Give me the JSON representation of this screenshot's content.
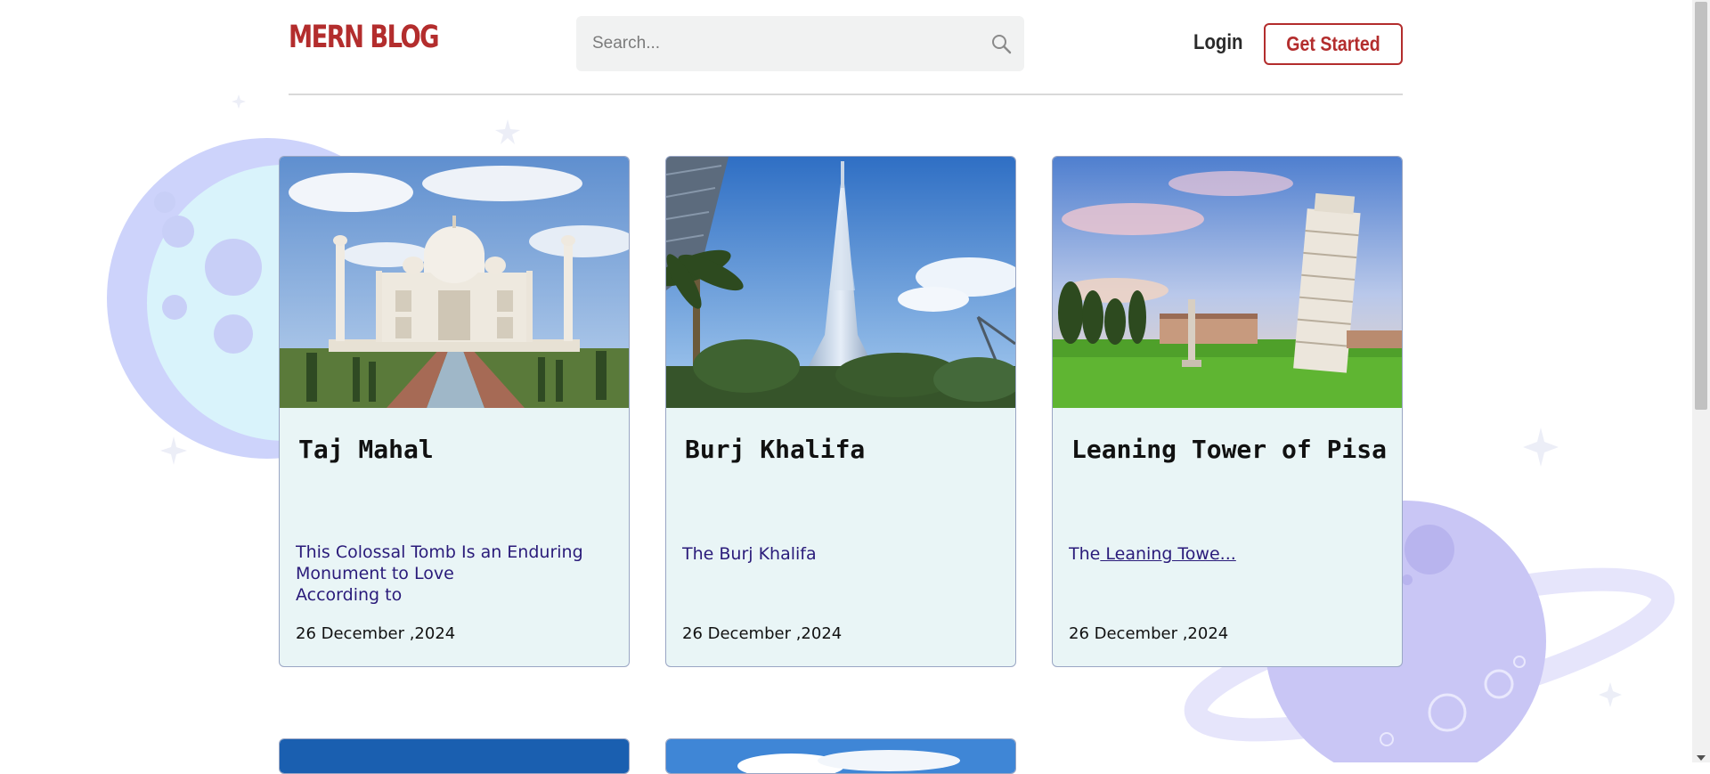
{
  "header": {
    "logo": "MERN BLOG",
    "search_placeholder": "Search...",
    "login_label": "Login",
    "cta_label": "Get Started"
  },
  "posts": [
    {
      "title": "Taj Mahal",
      "description": "This Colossal Tomb Is an Enduring Monument to Love",
      "description_overflow": "According to",
      "date": "26 December ,2024",
      "image_icon": "taj-mahal-photo"
    },
    {
      "title": "Burj Khalifa",
      "description": "The Burj Khalifa",
      "date": "26 December ,2024",
      "image_icon": "burj-khalifa-photo"
    },
    {
      "title": "Leaning Tower of Pisa",
      "description_prefix": "The",
      "description_link": " Leaning Towe...",
      "date": "26 December ,2024",
      "image_icon": "pisa-tower-photo"
    }
  ],
  "colors": {
    "brand": "#b32d2d",
    "card_bg": "#e9f5f6",
    "card_border": "#9aa6c4",
    "description_text": "#2a1b7a",
    "decor_planet": "#c9c6f5"
  }
}
